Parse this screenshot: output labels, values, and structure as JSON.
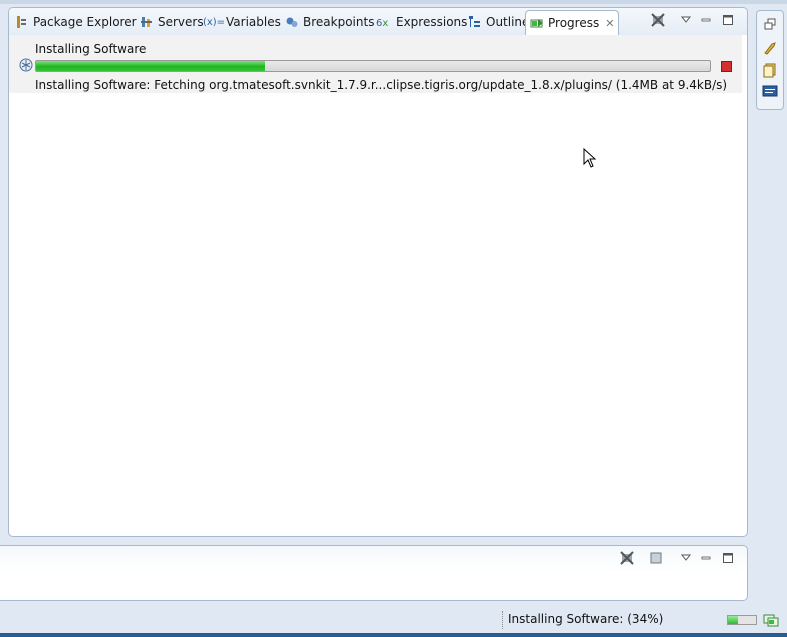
{
  "tabs": [
    {
      "label": "Package Explorer",
      "icon": "package-explorer-icon"
    },
    {
      "label": "Servers",
      "icon": "servers-icon"
    },
    {
      "label": "Variables",
      "icon": "variables-icon"
    },
    {
      "label": "Breakpoints",
      "icon": "breakpoints-icon"
    },
    {
      "label": "Expressions",
      "icon": "expressions-icon"
    },
    {
      "label": "Outline",
      "icon": "outline-icon"
    },
    {
      "label": "Progress",
      "icon": "progress-icon",
      "active": true,
      "close": "✕"
    }
  ],
  "progress": {
    "title": "Installing Software",
    "detail": "Installing Software: Fetching org.tmatesoft.svnkit_1.7.9.r...clipse.tigris.org/update_1.8.x/plugins/ (1.4MB at 9.4kB/s)",
    "fraction": 0.34
  },
  "status": {
    "text": "Installing Software: (34%)",
    "fraction": 0.34
  },
  "colors": {
    "progress_green": "#1fb61f",
    "stop_red": "#d23030",
    "panel_border": "#a9b9cc",
    "background": "#dfe8f3"
  }
}
